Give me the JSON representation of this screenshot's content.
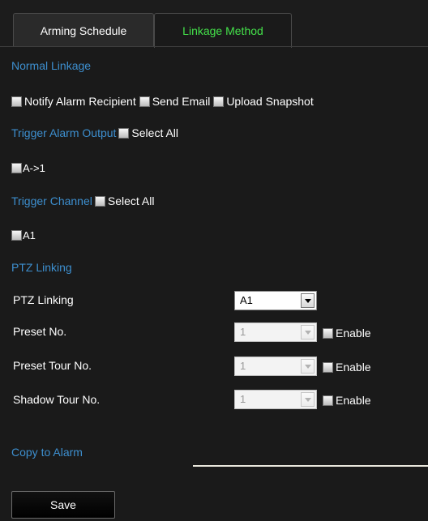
{
  "tabs": [
    {
      "label": "Arming Schedule",
      "active": false
    },
    {
      "label": "Linkage Method",
      "active": true
    }
  ],
  "normal_linkage": {
    "title": "Normal Linkage",
    "options": [
      {
        "label": "Notify Alarm Recipient",
        "checked": false
      },
      {
        "label": "Send Email",
        "checked": false
      },
      {
        "label": "Upload Snapshot",
        "checked": false
      }
    ]
  },
  "trigger_alarm_output": {
    "title": "Trigger Alarm Output",
    "select_all_label": "Select All",
    "items": [
      {
        "label": "A->1",
        "checked": false
      }
    ]
  },
  "trigger_channel": {
    "title": "Trigger Channel",
    "select_all_label": "Select All",
    "items": [
      {
        "label": "A1",
        "checked": false
      }
    ]
  },
  "ptz_linking": {
    "title": "PTZ Linking",
    "channel_label": "PTZ Linking",
    "channel_value": "A1",
    "preset_label": "Preset No.",
    "preset_value": "1",
    "preset_tour_label": "Preset Tour No.",
    "preset_tour_value": "1",
    "shadow_tour_label": "Shadow Tour No.",
    "shadow_tour_value": "1",
    "enable_label": "Enable"
  },
  "copy_to_alarm": {
    "title": "Copy to Alarm"
  },
  "save_label": "Save",
  "colors": {
    "background": "#1a1a1a",
    "section_title": "#3d8fcf",
    "active_tab": "#44e24a",
    "text": "#ffffff"
  }
}
